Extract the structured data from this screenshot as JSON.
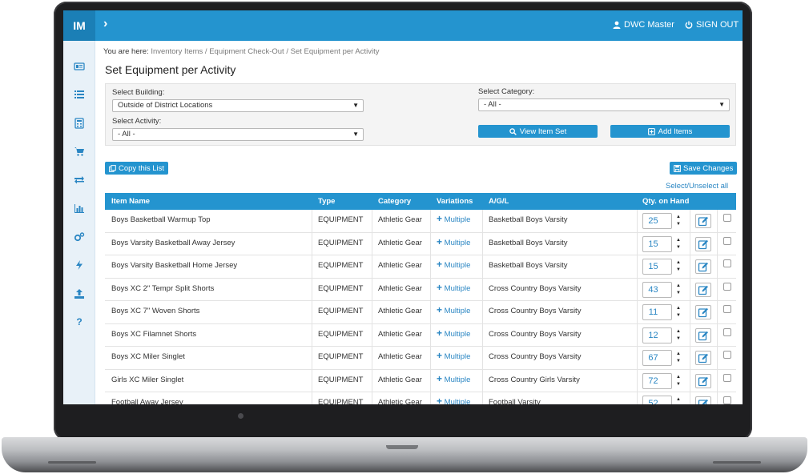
{
  "brand": "IM",
  "header": {
    "user_label": "DWC Master",
    "signout_label": "SIGN OUT"
  },
  "breadcrumb": {
    "prefix": "You are here:",
    "items": [
      "Inventory Items",
      "Equipment Check-Out",
      "Set Equipment per Activity"
    ],
    "separator": " / "
  },
  "page_title": "Set Equipment per Activity",
  "filters": {
    "building_label": "Select Building:",
    "building_value": "Outside of District Locations",
    "activity_label": "Select Activity:",
    "activity_value": "- All -",
    "category_label": "Select Category:",
    "category_value": "- All -",
    "view_item_set_label": "View Item Set",
    "add_items_label": "Add Items"
  },
  "toolbar": {
    "copy_list_label": "Copy this List",
    "save_changes_label": "Save Changes",
    "select_all_label": "Select/Unselect all"
  },
  "table": {
    "headers": [
      "Item Name",
      "Type",
      "Category",
      "Variations",
      "A/G/L",
      "Qty. on Hand"
    ],
    "variations_label": "Multiple",
    "rows": [
      {
        "name": "Boys Basketball Warmup Top",
        "type": "EQUIPMENT",
        "category": "Athletic Gear",
        "agl": "Basketball Boys Varsity",
        "qty": "25"
      },
      {
        "name": "Boys Varsity Basketball Away Jersey",
        "type": "EQUIPMENT",
        "category": "Athletic Gear",
        "agl": "Basketball Boys Varsity",
        "qty": "15"
      },
      {
        "name": "Boys Varsity Basketball Home Jersey",
        "type": "EQUIPMENT",
        "category": "Athletic Gear",
        "agl": "Basketball Boys Varsity",
        "qty": "15"
      },
      {
        "name": "Boys XC 2\" Tempr Split Shorts",
        "type": "EQUIPMENT",
        "category": "Athletic Gear",
        "agl": "Cross Country Boys Varsity",
        "qty": "43"
      },
      {
        "name": "Boys XC 7\" Woven Shorts",
        "type": "EQUIPMENT",
        "category": "Athletic Gear",
        "agl": "Cross Country Boys Varsity",
        "qty": "11"
      },
      {
        "name": "Boys XC Filamnet Shorts",
        "type": "EQUIPMENT",
        "category": "Athletic Gear",
        "agl": "Cross Country Boys Varsity",
        "qty": "12"
      },
      {
        "name": "Boys XC Miler Singlet",
        "type": "EQUIPMENT",
        "category": "Athletic Gear",
        "agl": "Cross Country Boys Varsity",
        "qty": "67"
      },
      {
        "name": "Girls XC Miler Singlet",
        "type": "EQUIPMENT",
        "category": "Athletic Gear",
        "agl": "Cross Country Girls Varsity",
        "qty": "72"
      },
      {
        "name": "Football Away Jersey",
        "type": "EQUIPMENT",
        "category": "Athletic Gear",
        "agl": "Football Varsity",
        "qty": "52"
      }
    ]
  },
  "colors": {
    "primary": "#2494cf",
    "brand_dark": "#1b7fb6",
    "link": "#2a86c3",
    "sidebar_bg": "#e8f1f8"
  }
}
